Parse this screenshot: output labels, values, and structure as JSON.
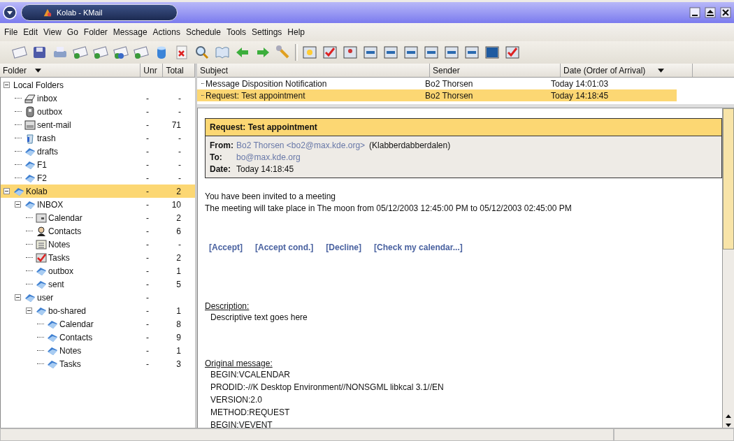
{
  "window": {
    "title": "Kolab - KMail"
  },
  "menu": [
    "File",
    "Edit",
    "View",
    "Go",
    "Folder",
    "Message",
    "Actions",
    "Schedule",
    "Tools",
    "Settings",
    "Help"
  ],
  "folder_columns": [
    "Folder",
    "Unr",
    "Total"
  ],
  "folders": [
    {
      "name": "Local Folders",
      "kind": "root",
      "expanded": true,
      "selected": false,
      "children": [
        {
          "name": "inbox",
          "kind": "inbox",
          "unread": "-",
          "total": "-",
          "selected": false
        },
        {
          "name": "outbox",
          "kind": "outbox",
          "unread": "-",
          "total": "-",
          "selected": false
        },
        {
          "name": "sent-mail",
          "kind": "sent",
          "unread": "-",
          "total": "71",
          "selected": false
        },
        {
          "name": "trash",
          "kind": "trash",
          "unread": "-",
          "total": "-",
          "selected": false
        },
        {
          "name": "drafts",
          "kind": "folder",
          "unread": "-",
          "total": "-",
          "selected": false
        },
        {
          "name": "F1",
          "kind": "folder",
          "unread": "-",
          "total": "-",
          "selected": false
        },
        {
          "name": "F2",
          "kind": "folder",
          "unread": "-",
          "total": "-",
          "selected": false
        }
      ]
    },
    {
      "name": "Kolab",
      "kind": "folder",
      "unread": "-",
      "total": "2",
      "expanded": true,
      "selected": true,
      "children": [
        {
          "name": "INBOX",
          "kind": "folder",
          "unread": "-",
          "total": "10",
          "expanded": true,
          "selected": false,
          "children": [
            {
              "name": "Calendar",
              "kind": "calendar",
              "unread": "-",
              "total": "2",
              "selected": false
            },
            {
              "name": "Contacts",
              "kind": "contacts",
              "unread": "-",
              "total": "6",
              "selected": false
            },
            {
              "name": "Notes",
              "kind": "notes",
              "unread": "-",
              "total": "-",
              "selected": false
            },
            {
              "name": "Tasks",
              "kind": "tasks",
              "unread": "-",
              "total": "2",
              "selected": false
            },
            {
              "name": "outbox",
              "kind": "folder",
              "unread": "-",
              "total": "1",
              "selected": false
            },
            {
              "name": "sent",
              "kind": "folder",
              "unread": "-",
              "total": "5",
              "selected": false
            }
          ]
        },
        {
          "name": "user",
          "kind": "folder",
          "unread": "-",
          "expanded": true,
          "selected": false,
          "children": [
            {
              "name": "bo-shared",
              "kind": "folder",
              "unread": "-",
              "total": "1",
              "expanded": true,
              "selected": false,
              "children": [
                {
                  "name": "Calendar",
                  "kind": "folder",
                  "unread": "-",
                  "total": "8",
                  "selected": false
                },
                {
                  "name": "Contacts",
                  "kind": "folder",
                  "unread": "-",
                  "total": "9",
                  "selected": false
                },
                {
                  "name": "Notes",
                  "kind": "folder",
                  "unread": "-",
                  "total": "1",
                  "selected": false
                },
                {
                  "name": "Tasks",
                  "kind": "folder",
                  "unread": "-",
                  "total": "3",
                  "selected": false
                }
              ]
            }
          ]
        }
      ]
    }
  ],
  "message_columns": [
    "Subject",
    "Sender",
    "Date (Order of Arrival)"
  ],
  "messages": [
    {
      "subject": "Message Disposition Notification",
      "sender": "Bo2 Thorsen",
      "date": "Today 14:01:03",
      "selected": false
    },
    {
      "subject": "Request: Test appointment",
      "sender": "Bo2 Thorsen",
      "date": "Today 14:18:45",
      "selected": true
    }
  ],
  "reader": {
    "header_title": "Request: Test appointment",
    "fields": [
      {
        "label": "From:",
        "value": "Bo2 Thorsen <bo2@max.kde.org>",
        "kind": "link",
        "extra": "(Klabberdabberdalen)"
      },
      {
        "label": "To:",
        "value": "bo@max.kde.org",
        "kind": "link"
      },
      {
        "label": "Date:",
        "value": "Today 14:18:45",
        "kind": "plain"
      }
    ],
    "intro": [
      "You have been invited to a meeting",
      "The meeting will take place in The moon from 05/12/2003 12:45:00 PM to 05/12/2003 02:45:00 PM"
    ],
    "actions": [
      "[Accept]",
      "[Accept cond.]",
      "[Decline]",
      "[Check my calendar...]"
    ],
    "description_heading": "Description:",
    "description": "Descriptive text goes here",
    "original_heading": "Original message:",
    "original_lines": [
      "BEGIN:VCALENDAR",
      "PRODID:-//K Desktop Environment//NONSGML libkcal 3.1//EN",
      "VERSION:2.0",
      "METHOD:REQUEST",
      "BEGIN:VEVENT"
    ]
  }
}
